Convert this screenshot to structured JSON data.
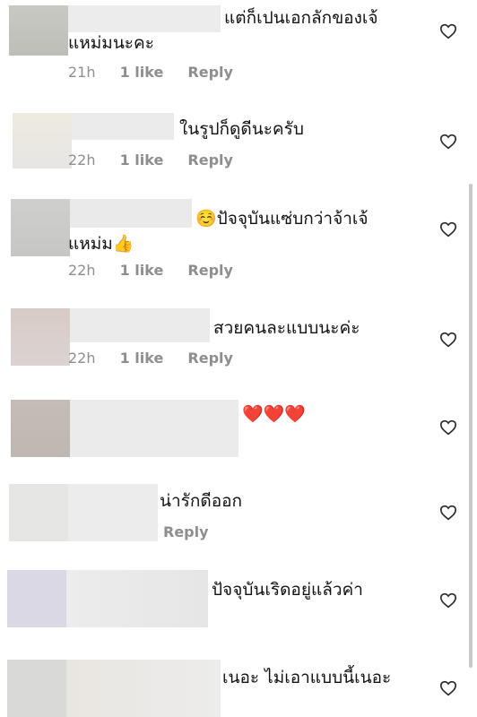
{
  "comments": [
    {
      "line1": "แต่ก็เปนเอกลักของเจ้",
      "line2": "แหม่มนะคะ",
      "time": "21h",
      "likes": "1 like",
      "reply": "Reply"
    },
    {
      "line1": "ในรูปก็ดูดีนะครับ",
      "time": "22h",
      "likes": "1 like",
      "reply": "Reply"
    },
    {
      "emoji_before": "☺️",
      "line1": "ปัจจุบันแซ่บกว่าจ้าเจ้",
      "line2": "แหม่ม",
      "emoji_after": "👍",
      "time": "22h",
      "likes": "1 like",
      "reply": "Reply"
    },
    {
      "line1": "สวยคนละแบบนะค่ะ",
      "time": "22h",
      "likes": "1 like",
      "reply": "Reply"
    },
    {
      "line1": "❤️❤️❤️"
    },
    {
      "line1": "น่ารักดีออก",
      "reply": "Reply"
    },
    {
      "line1": "ปัจจุบันเริดอยู่แล้วค่า"
    },
    {
      "line1": "เนอะ ไม่เอาแบบนี้เนอะ"
    }
  ],
  "colors": {
    "meta": "#8e8e8e",
    "heart_icon": "#262626",
    "blur_light": "#ebebeb",
    "blur_mid": "#dcdcdc"
  },
  "icons": {
    "like": "heart-outline-icon",
    "thumbs": "thumbs-up-emoji",
    "smile": "smiling-emoji"
  }
}
